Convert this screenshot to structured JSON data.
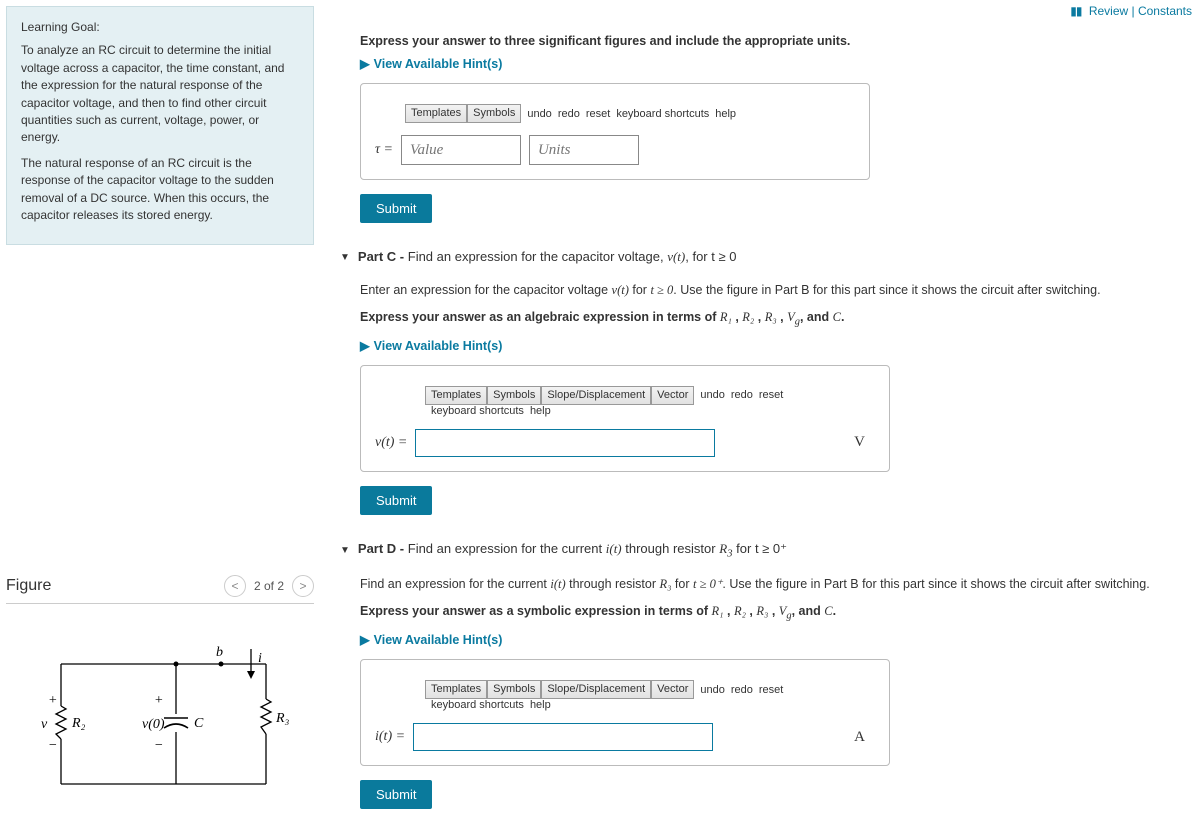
{
  "topLinks": {
    "review": "Review",
    "constants": "Constants"
  },
  "learningGoal": {
    "title": "Learning Goal:",
    "p1": "To analyze an RC circuit to determine the initial voltage across a capacitor, the time constant, and the expression for the natural response of the capacitor voltage, and then to find other circuit quantities such as current, voltage, power, or energy.",
    "p2": "The natural response of an RC circuit is the response of the capacitor voltage to the sudden removal of a DC source. When this occurs, the capacitor releases its stored energy."
  },
  "figure": {
    "title": "Figure",
    "counter": "2 of 2",
    "labels": {
      "b": "b",
      "i": "i",
      "R3": "R₃",
      "R2": "R₂",
      "C": "C",
      "v": "v",
      "v0": "v(0)",
      "plus": "+",
      "minus": "−"
    }
  },
  "partTop": {
    "instr": "Express your answer to three significant figures and include the appropriate units.",
    "hints": "View Available Hint(s)",
    "tauLabel": "τ =",
    "valuePH": "Value",
    "unitsPH": "Units",
    "submit": "Submit"
  },
  "toolbar": {
    "templates": "Templates",
    "symbols": "Symbols",
    "slope": "Slope/Displacement",
    "vector": "Vector",
    "undo": "undo",
    "redo": "redo",
    "reset": "reset",
    "kbd": "keyboard shortcuts",
    "help": "help"
  },
  "partC": {
    "header_bold": "Part C - ",
    "header_rest": "Find an expression for the capacitor voltage, ",
    "header_var": "v(t)",
    "header_tail": ", for t ≥ 0",
    "desc1a": "Enter an expression for the capacitor voltage ",
    "desc1b": " for ",
    "desc1c": ". Use the figure in Part B for this part since it shows the circuit after switching.",
    "desc2a": "Express your answer as an algebraic expression in terms of ",
    "desc2b": ", and ",
    "desc2c": ".",
    "hints": "View Available Hint(s)",
    "label": "v(t) = ",
    "unit": "V",
    "submit": "Submit"
  },
  "partD": {
    "header_bold": "Part D - ",
    "header_rest": "Find an expression for the current ",
    "header_var": "i(t)",
    "header_mid": " through resistor ",
    "header_R": "R",
    "header_tail": " for t ≥ 0⁺",
    "desc1a": "Find an expression for the current ",
    "desc1b": " through resistor ",
    "desc1c": " for ",
    "desc1d": ". Use the figure in Part B for this part since it shows the circuit after switching.",
    "desc2a": "Express your answer as a symbolic expression in terms of ",
    "desc2b": ", and ",
    "desc2c": ".",
    "hints": "View Available Hint(s)",
    "label": "i(t) = ",
    "unit": "A",
    "submit": "Submit"
  },
  "mathvars": {
    "vt": "v(t)",
    "it": "i(t)",
    "tge0": "t ≥ 0",
    "tge0p": "t ≥ 0⁺",
    "R1": "R₁",
    "R2": "R₂",
    "R3": "R₃",
    "Vg": "V_g",
    "C": "C"
  }
}
